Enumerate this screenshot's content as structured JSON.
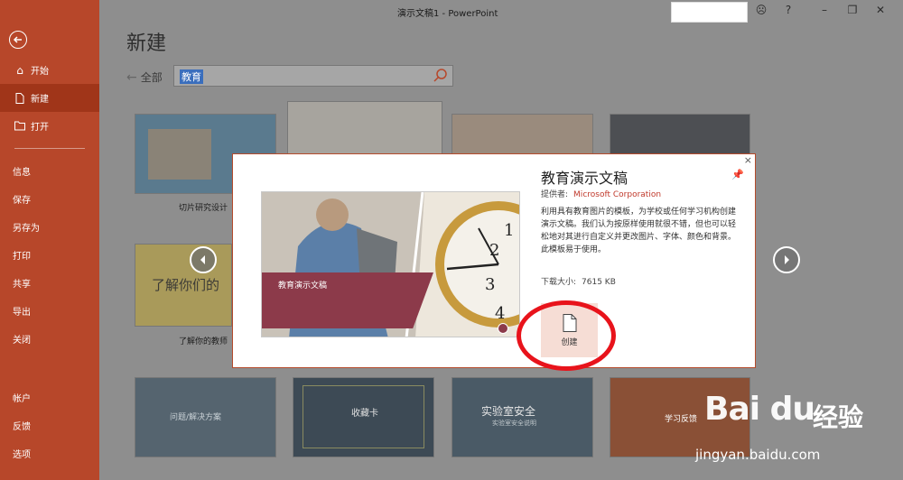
{
  "window": {
    "title": "演示文稿1 - PowerPoint"
  },
  "sidebar": {
    "items_top": [
      {
        "label": "开始",
        "icon": "home-icon"
      },
      {
        "label": "新建",
        "icon": "new-document-icon",
        "active": true
      },
      {
        "label": "打开",
        "icon": "folder-open-icon"
      }
    ],
    "items_middle": [
      "信息",
      "保存",
      "另存为",
      "打印",
      "共享",
      "导出",
      "关闭"
    ],
    "items_bottom": [
      "帐户",
      "反馈",
      "选项"
    ]
  },
  "page": {
    "title": "新建",
    "breadcrumb": "全部",
    "search_value": "教育"
  },
  "templates": [
    {
      "label": "切片研究设计"
    },
    {
      "label": "了解你的教师"
    },
    {
      "label": "问题/解决方案"
    },
    {
      "label": "收藏卡"
    },
    {
      "label": "实验室安全"
    },
    {
      "label": "学习反馈"
    }
  ],
  "thumbnail_text": {
    "tile_lead": "了解你们的",
    "tile_lab_sub": "实验室安全说明"
  },
  "modal": {
    "title": "教育演示文稿",
    "provider_label": "提供者:",
    "provider_value": "Microsoft Corporation",
    "description": "利用具有教育图片的模板，为学校或任何学习机构创建演示文稿。我们认为按原样使用就很不错，但也可以轻松地对其进行自定义并更改图片、字体、颜色和背景。此模板易于使用。",
    "size_label": "下载大小:",
    "size_value": "7615 KB",
    "preview_caption": "教育演示文稿",
    "create_label": "创建"
  },
  "watermark": {
    "logo": "Bai du",
    "cn": "经验",
    "url": "jingyan.baidu.com"
  },
  "colors": {
    "accent": "#b7472a",
    "highlight_circle": "#e8131b",
    "caption_bg": "#8c3a4a"
  }
}
